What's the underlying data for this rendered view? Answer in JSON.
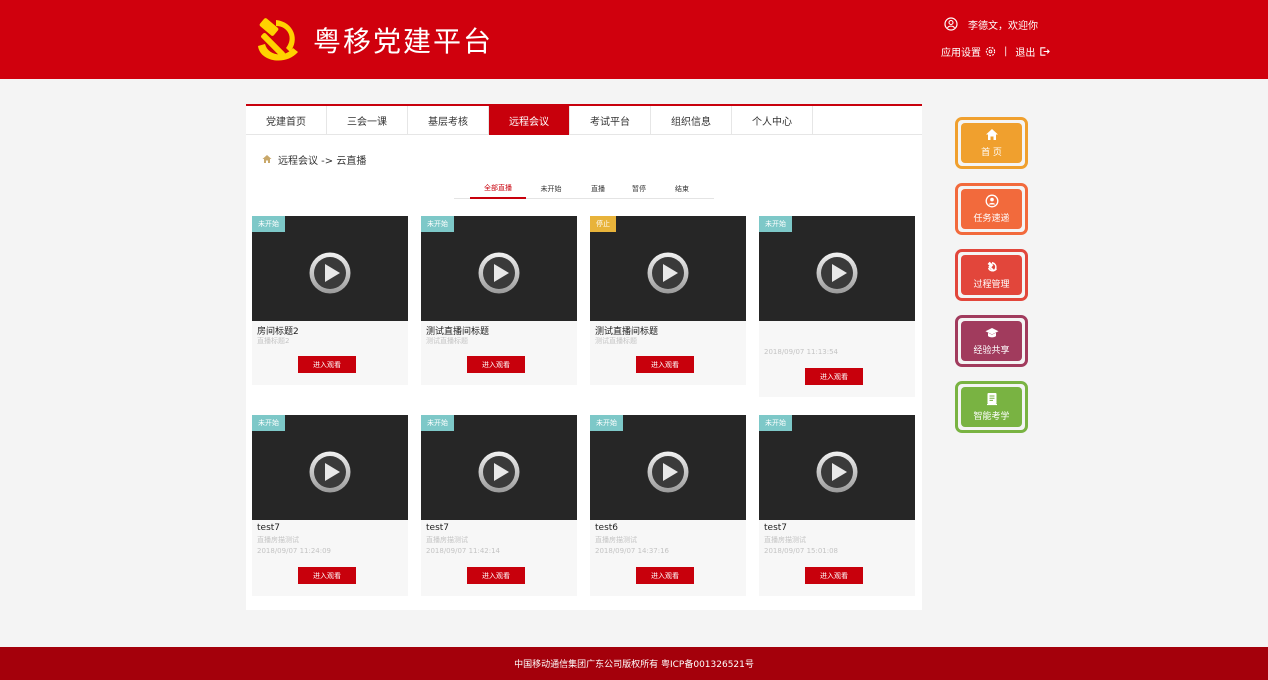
{
  "header": {
    "site_title": "粤移党建平台",
    "user_greeting": "李德文，欢迎你",
    "settings_label": "应用设置",
    "logout_label": "退出"
  },
  "nav": {
    "items": [
      "党建首页",
      "三会一课",
      "基层考核",
      "远程会议",
      "考试平台",
      "组织信息",
      "个人中心"
    ],
    "active": "远程会议"
  },
  "breadcrumb": {
    "text": "远程会议 -> 云直播"
  },
  "subtabs": [
    "全部直播",
    "未开始",
    "直播",
    "暂停",
    "结束"
  ],
  "cards": [
    {
      "badge": "未开始",
      "title": "房间标题2",
      "subtitle": "直播标题2",
      "time": "",
      "button": "进入观看"
    },
    {
      "badge": "未开始",
      "title": "测试直播间标题",
      "subtitle": "测试直播标题",
      "time": "",
      "button": "进入观看"
    },
    {
      "badge": "停止",
      "title": "测试直播间标题",
      "subtitle": "测试直播标题",
      "time": "",
      "button": "进入观看"
    },
    {
      "badge": "未开始",
      "title": "",
      "subtitle": "",
      "time": "2018/09/07 11:13:54",
      "button": "进入观看"
    },
    {
      "badge": "未开始",
      "title": "test7",
      "subtitle": "直播房描测试",
      "time": "2018/09/07 11:24:09",
      "button": "进入观看"
    },
    {
      "badge": "未开始",
      "title": "test7",
      "subtitle": "直播房描测试",
      "time": "2018/09/07 11:42:14",
      "button": "进入观看"
    },
    {
      "badge": "未开始",
      "title": "test6",
      "subtitle": "直播房描测试",
      "time": "2018/09/07 14:37:16",
      "button": "进入观看"
    },
    {
      "badge": "未开始",
      "title": "test7",
      "subtitle": "直播房描测试",
      "time": "2018/09/07 15:01:08",
      "button": "进入观看"
    }
  ],
  "quick_links": [
    {
      "label": "首 页",
      "icon": "home-icon",
      "color": "#f0a02e"
    },
    {
      "label": "任务速递",
      "icon": "user-circle-icon",
      "color": "#f26a3c"
    },
    {
      "label": "过程管理",
      "icon": "hammer-sickle-icon",
      "color": "#e2463b"
    },
    {
      "label": "经验共享",
      "icon": "graduation-cap-icon",
      "color": "#a13b5d"
    },
    {
      "label": "智能考学",
      "icon": "document-icon",
      "color": "#79b342"
    }
  ],
  "footer": {
    "text": "中国移动通信集团广东公司版权所有 粤ICP备001326521号"
  },
  "colors": {
    "brand_red": "#d0000d",
    "button_red": "#c8000c",
    "footer_red": "#a4000b"
  }
}
